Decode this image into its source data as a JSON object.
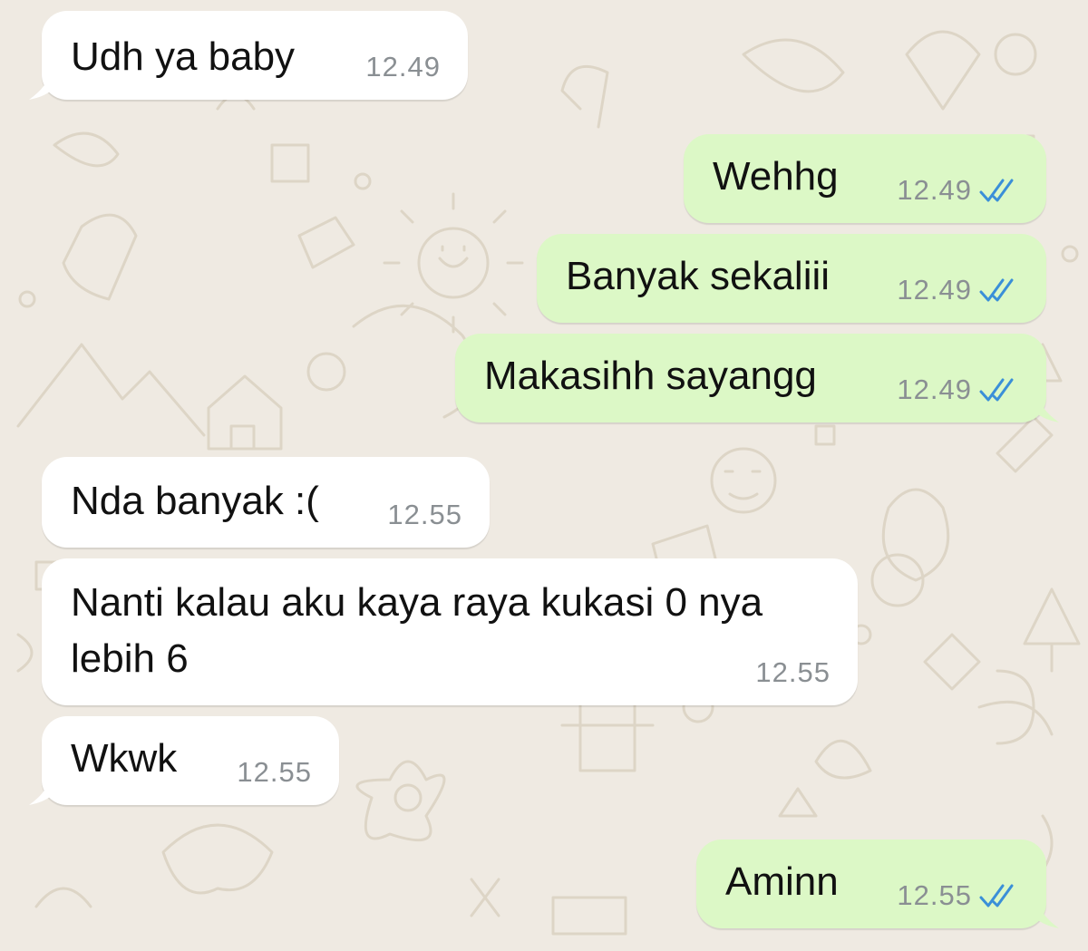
{
  "colors": {
    "incoming_bubble": "#ffffff",
    "outgoing_bubble": "#dcf8c6",
    "chat_background": "#efeae2",
    "read_tick": "#3a8fd8",
    "timestamp": "#8a8f93"
  },
  "icons": {
    "read_receipt": "double-check-icon"
  },
  "messages": [
    {
      "direction": "in",
      "text": "Udh ya baby",
      "time": "12.49"
    },
    {
      "direction": "out",
      "text": "Wehhg",
      "time": "12.49",
      "status": "read"
    },
    {
      "direction": "out",
      "text": "Banyak sekaliii",
      "time": "12.49",
      "status": "read"
    },
    {
      "direction": "out",
      "text": "Makasihh sayangg",
      "time": "12.49",
      "status": "read"
    },
    {
      "direction": "in",
      "text": "Nda banyak :(",
      "time": "12.55"
    },
    {
      "direction": "in",
      "text": "Nanti kalau aku kaya raya kukasi 0 nya lebih 6",
      "time": "12.55"
    },
    {
      "direction": "in",
      "text": "Wkwk",
      "time": "12.55"
    },
    {
      "direction": "out",
      "text": "Aminn",
      "time": "12.55",
      "status": "read"
    }
  ]
}
